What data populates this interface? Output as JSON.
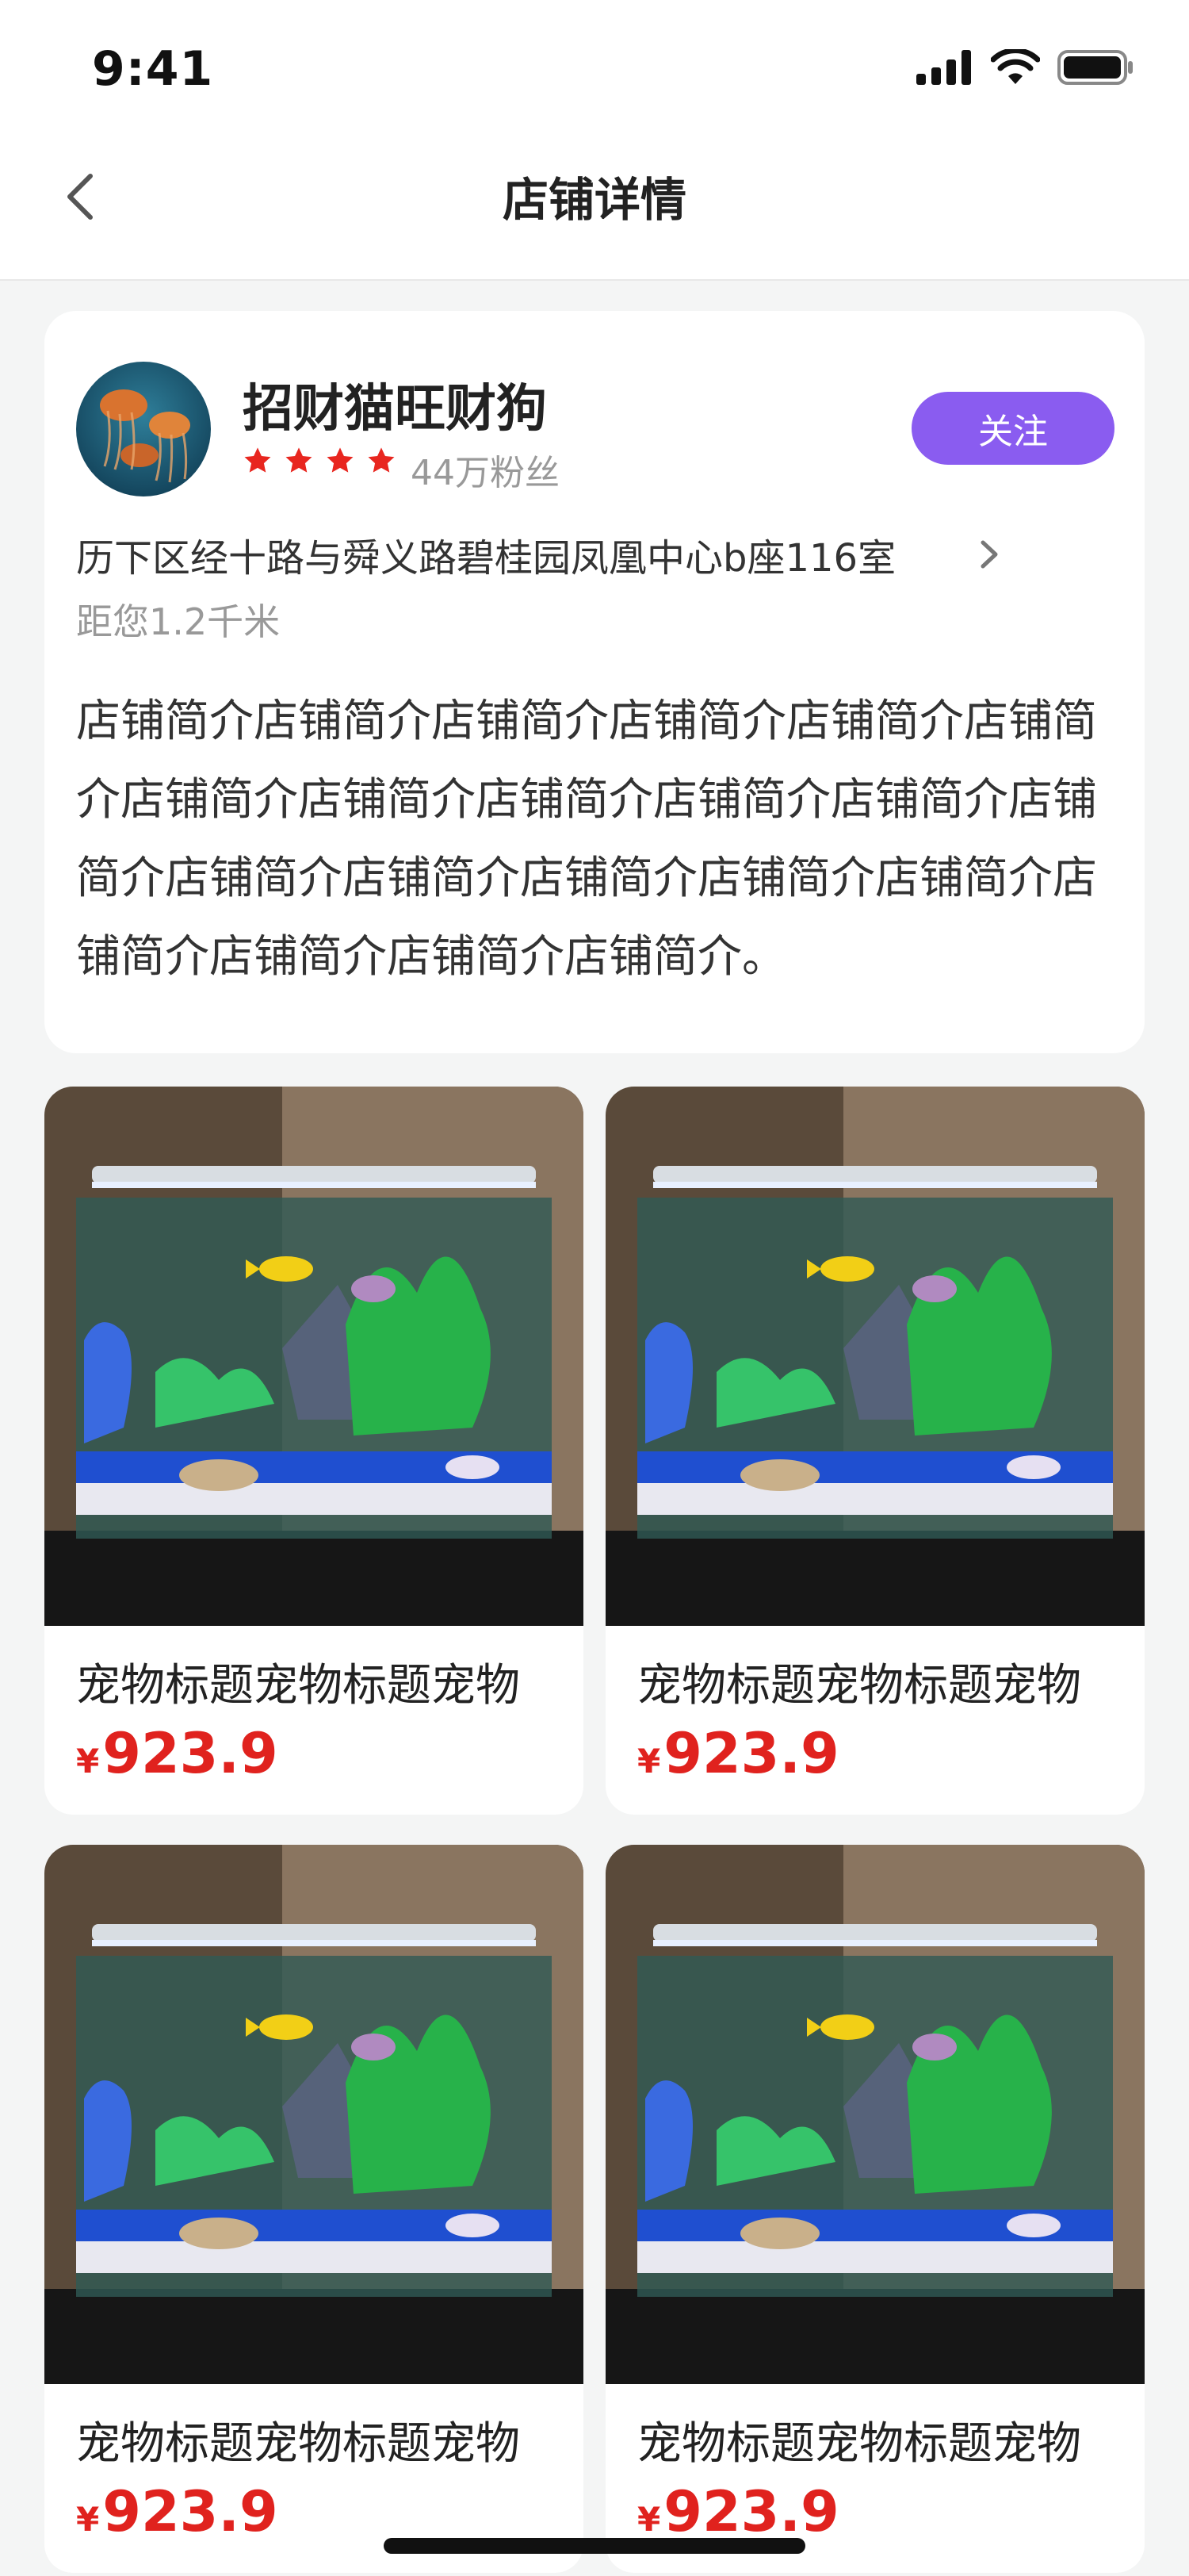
{
  "status_bar": {
    "time": "9:41"
  },
  "nav": {
    "title": "店铺详情"
  },
  "shop": {
    "name": "招财猫旺财狗",
    "rating_stars": 4,
    "fans": "44万粉丝",
    "follow_label": "关注",
    "address": "历下区经十路与舜义路碧桂园凤凰中心b座116室",
    "distance": "距您1.2千米",
    "intro": "店铺简介店铺简介店铺简介店铺简介店铺简介店铺简介店铺简介店铺简介店铺简介店铺简介店铺简介店铺简介店铺简介店铺简介店铺简介店铺简介店铺简介店铺简介店铺简介店铺简介店铺简介。"
  },
  "products": [
    {
      "title": "宠物标题宠物标题宠物",
      "currency": "¥",
      "price": "923.9"
    },
    {
      "title": "宠物标题宠物标题宠物",
      "currency": "¥",
      "price": "923.9"
    },
    {
      "title": "宠物标题宠物标题宠物",
      "currency": "¥",
      "price": "923.9"
    },
    {
      "title": "宠物标题宠物标题宠物",
      "currency": "¥",
      "price": "923.9"
    }
  ],
  "colors": {
    "accent": "#8a5cf0",
    "price": "#e0221e",
    "star": "#e8261f"
  }
}
